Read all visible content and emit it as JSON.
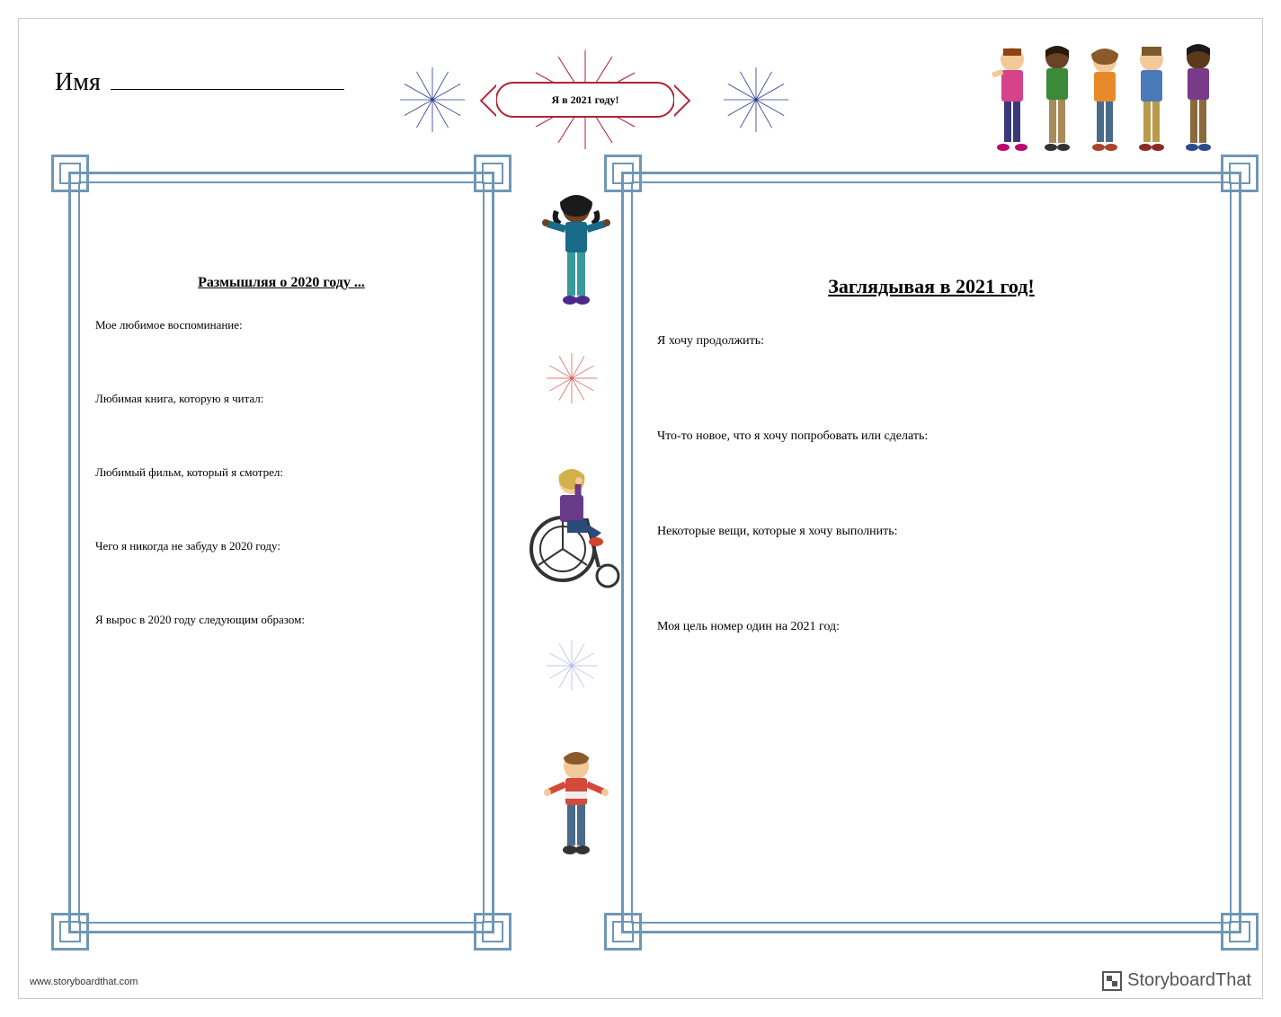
{
  "name_label": "Имя",
  "banner_text": "Я в 2021 году!",
  "left_panel": {
    "title": "Размышляя о 2020 году ...",
    "prompts": [
      "Мое любимое воспоминание:",
      "Любимая книга, которую я читал:",
      "Любимый фильм, который я смотрел:",
      "Чего я никогда не забуду в 2020 году:",
      "Я вырос в 2020 году следующим образом:"
    ]
  },
  "right_panel": {
    "title": "Заглядывая в 2021 год!",
    "prompts": [
      "Я хочу продолжить:",
      "Что-то новое, что я хочу попробовать или сделать:",
      "Некоторые вещи, которые я хочу выполнить:",
      "Моя цель номер один на 2021 год:"
    ]
  },
  "footer": {
    "url": "www.storyboardthat.com",
    "brand": "StoryboardThat"
  },
  "colors": {
    "frame": "#6f97b4",
    "red": "#B22234",
    "blue": "#2b3a8f"
  }
}
